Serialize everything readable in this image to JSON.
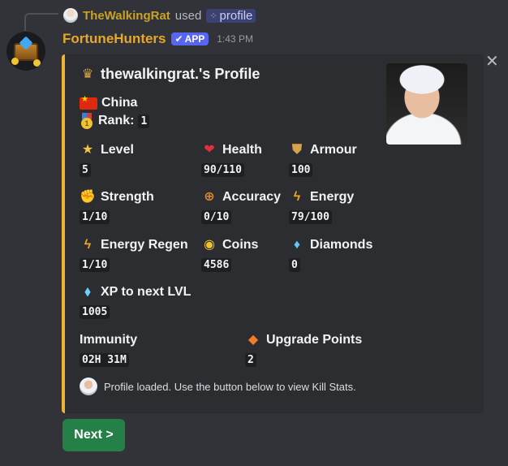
{
  "reply": {
    "username": "TheWalkingRat",
    "used_text": "used",
    "command_icon": "slash-command-icon",
    "command": "profile"
  },
  "message": {
    "bot_name": "FortuneHunters",
    "badge": "APP",
    "badge_icon": "checkmark-icon",
    "timestamp": "1:43 PM"
  },
  "embed": {
    "accent_color": "#f0b232",
    "title_icon": "profile-crest-icon",
    "title": "thewalkingrat.'s Profile",
    "country": "China",
    "country_icon": "flag-china-icon",
    "rank_label": "Rank:",
    "rank_icon": "medal-icon",
    "rank_value": "1",
    "fields": [
      {
        "icon": "star-icon",
        "name": "Level",
        "value": "5"
      },
      {
        "icon": "heart-icon",
        "name": "Health",
        "value": "90/110"
      },
      {
        "icon": "shield-icon",
        "name": "Armour",
        "value": "100"
      },
      {
        "icon": "bicep-icon",
        "name": "Strength",
        "value": "1/10"
      },
      {
        "icon": "crosshair-icon",
        "name": "Accuracy",
        "value": "0/10"
      },
      {
        "icon": "lightning-icon",
        "name": "Energy",
        "value": "79/100"
      },
      {
        "icon": "lightning-regen-icon",
        "name": "Energy Regen",
        "value": "1/10"
      },
      {
        "icon": "coins-icon",
        "name": "Coins",
        "value": "4586"
      },
      {
        "icon": "diamond-icon",
        "name": "Diamonds",
        "value": "0"
      },
      {
        "icon": "crystal-icon",
        "name": "XP to next LVL",
        "value": "1005"
      },
      {
        "icon": "",
        "name": "Immunity",
        "value": "02H 31M"
      },
      {
        "icon": "upgrade-gem-icon",
        "name": "Upgrade Points",
        "value": "2"
      }
    ],
    "footer": "Profile loaded. Use the button below to view Kill Stats."
  },
  "buttons": {
    "next_label": "Next >"
  }
}
